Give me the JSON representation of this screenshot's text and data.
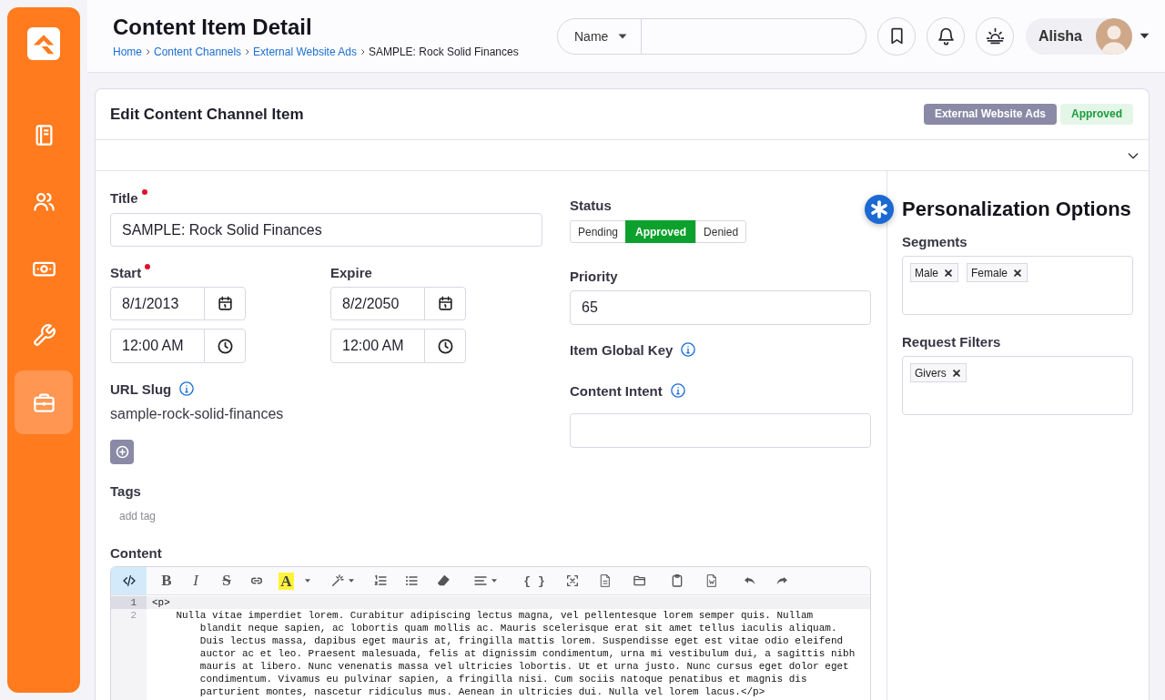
{
  "sidebar": {
    "items": [
      {
        "kind": "notebook",
        "selected": false
      },
      {
        "kind": "people",
        "selected": false
      },
      {
        "kind": "money",
        "selected": false
      },
      {
        "kind": "wrench",
        "selected": false
      },
      {
        "kind": "briefcase",
        "selected": true
      }
    ]
  },
  "header": {
    "title": "Content Item Detail",
    "breadcrumb": [
      {
        "label": "Home",
        "current": false
      },
      {
        "label": "Content Channels",
        "current": false
      },
      {
        "label": "External Website Ads",
        "current": false
      },
      {
        "label": "SAMPLE: Rock Solid Finances",
        "current": true
      }
    ],
    "search": {
      "filter": "Name"
    },
    "actions": [
      {
        "kind": "bookmark"
      },
      {
        "kind": "bell"
      },
      {
        "kind": "theme"
      }
    ],
    "user": {
      "name": "Alisha"
    }
  },
  "card": {
    "title": "Edit Content Channel Item",
    "badges": [
      {
        "label": "External Website Ads",
        "kind": "channel"
      },
      {
        "label": "Approved",
        "kind": "status"
      }
    ],
    "expanded": false
  },
  "form": {
    "title": {
      "label": "Title",
      "required": true,
      "value": "SAMPLE: Rock Solid Finances"
    },
    "start": {
      "label": "Start",
      "required": true,
      "date": "8/1/2013",
      "time": "12:00 AM"
    },
    "expire": {
      "label": "Expire",
      "date": "8/2/2050",
      "time": "12:00 AM"
    },
    "url_slug": {
      "label": "URL Slug",
      "info": true,
      "value": "sample-rock-solid-finances"
    },
    "tags": {
      "label": "Tags",
      "placeholder": "add tag"
    },
    "status": {
      "label": "Status",
      "options": [
        {
          "label": "Pending",
          "selected": false
        },
        {
          "label": "Approved",
          "selected": true
        },
        {
          "label": "Denied",
          "selected": false
        }
      ]
    },
    "priority": {
      "label": "Priority",
      "value": "65"
    },
    "item_global_key": {
      "label": "Item Global Key",
      "info": true
    },
    "content_intent": {
      "label": "Content Intent",
      "info": true
    },
    "content": {
      "label": "Content",
      "toolbar": [
        {
          "kind": "codeview",
          "active": true
        },
        {
          "kind": "bold",
          "label": "B",
          "active": false
        },
        {
          "kind": "italic",
          "label": "I",
          "active": false
        },
        {
          "kind": "strike",
          "label": "S",
          "active": false
        },
        {
          "kind": "link",
          "active": false
        },
        {
          "kind": "fontcolor",
          "label": "A",
          "active": false
        },
        {
          "kind": "magic",
          "active": false
        },
        {
          "kind": "ol",
          "active": false
        },
        {
          "kind": "ul",
          "active": false
        },
        {
          "kind": "eraser",
          "active": false
        },
        {
          "kind": "align",
          "active": false
        },
        {
          "kind": "braces",
          "label": "{ }",
          "active": false
        },
        {
          "kind": "corners",
          "active": false
        },
        {
          "kind": "textfile",
          "active": false
        },
        {
          "kind": "folder",
          "active": false
        },
        {
          "kind": "clipboard",
          "active": false
        },
        {
          "kind": "wordfile",
          "active": false
        },
        {
          "kind": "undo",
          "active": false
        },
        {
          "kind": "redo",
          "active": false
        }
      ],
      "lines": [
        {
          "number": "1",
          "text": "<p>",
          "active": true
        },
        {
          "number": "2",
          "text": "    Nulla vitae imperdiet lorem. Curabitur adipiscing lectus magna, vel pellentesque lorem semper quis. Nullam blandit neque sapien, ac lobortis quam mollis ac. Mauris scelerisque erat sit amet tellus iaculis aliquam. Duis lectus massa, dapibus eget mauris at, fringilla mattis lorem. Suspendisse eget est vitae odio eleifend auctor ac et leo. Praesent malesuada, felis at dignissim condimentum, urna mi vestibulum dui, a sagittis nibh mauris at libero. Nunc venenatis massa vel ultricies lobortis. Ut et urna justo. Nunc cursus eget dolor eget condimentum. Vivamus eu pulvinar sapien, a fringilla nisi. Cum sociis natoque penatibus et magnis dis parturient montes, nascetur ridiculus mus. Aenean in ultricies dui. Nulla vel lorem lacus.</p>",
          "active": false
        }
      ]
    }
  },
  "personalization": {
    "title": "Personalization Options",
    "segments": {
      "label": "Segments",
      "tags": [
        "Male",
        "Female"
      ]
    },
    "request_filters": {
      "label": "Request Filters",
      "tags": [
        "Givers"
      ]
    }
  }
}
